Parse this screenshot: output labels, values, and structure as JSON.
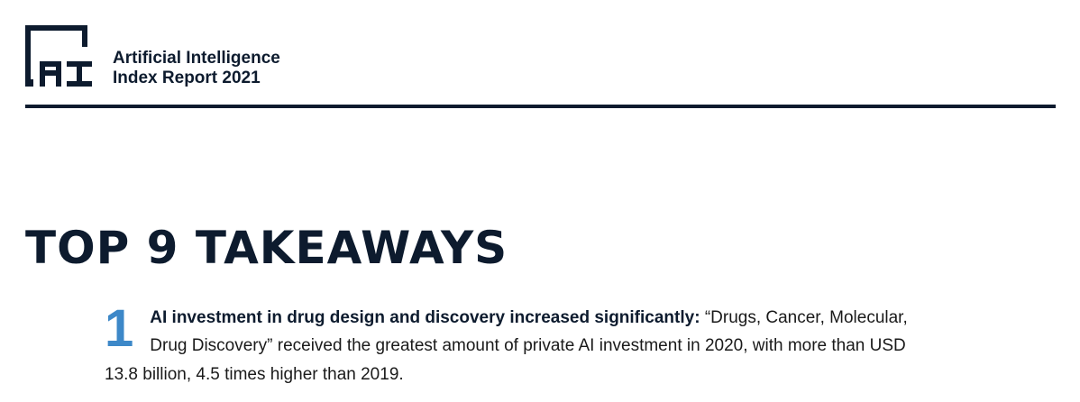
{
  "header": {
    "logo_icon": "ai-index-logo-icon",
    "title_line1": "Artificial Intelligence",
    "title_line2": "Index Report 2021"
  },
  "section": {
    "title": "TOP 9 TAKEAWAYS"
  },
  "takeaways": [
    {
      "number": "1",
      "heading": "AI investment in drug design and discovery increased significantly:",
      "body_line1": "“Drugs, Cancer, Molecular,",
      "body_line2": "Drug Discovery” received the greatest amount of private AI investment in 2020, with more than USD",
      "body_line3": "13.8 billion, 4.5 times higher than 2019."
    }
  ],
  "colors": {
    "navy": "#0d1b2e",
    "accent_blue": "#3d88c8"
  }
}
